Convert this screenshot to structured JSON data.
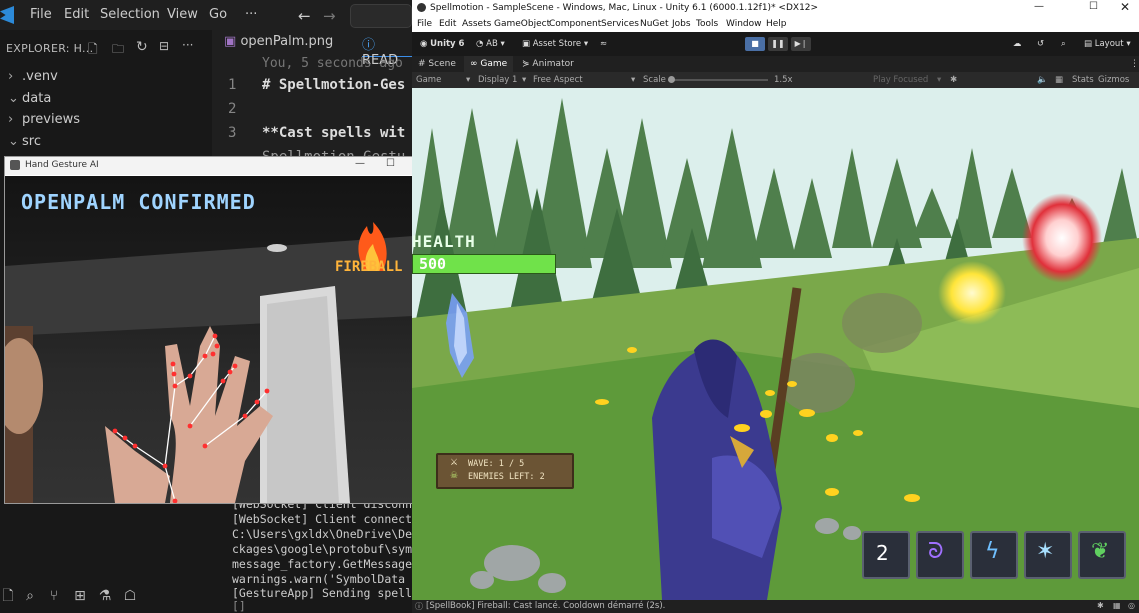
{
  "vscode": {
    "menu": [
      "File",
      "Edit",
      "Selection",
      "View",
      "Go",
      "···"
    ],
    "explorer_header": "EXPLORER: H...",
    "tree": [
      {
        "label": ".venv",
        "chevron": "›"
      },
      {
        "label": "data",
        "chevron": "⌄"
      },
      {
        "label": "previews",
        "chevron": "›"
      },
      {
        "label": "src",
        "chevron": "⌄"
      }
    ],
    "tabs": [
      "openPalm.png",
      "READ"
    ],
    "blame": "You, 5 seconds ago",
    "code_lines": [
      {
        "num": "1",
        "text": "# Spellmotion-Ges"
      },
      {
        "num": "2",
        "text": ""
      },
      {
        "num": "3",
        "text": "**Cast spells wit"
      }
    ],
    "code_partial": "Spellmotion-Gestu",
    "terminal": [
      "[WebSocket] Client disconn",
      "[WebSocket] Client connecte",
      "C:\\Users\\gxldx\\OneDrive\\Des",
      "ckages\\google\\protobuf\\symb",
      "  message_factory.GetMessage",
      "  warnings.warn('SymbolData",
      "[GestureApp] Sending spell",
      "[]"
    ]
  },
  "gesture_window": {
    "title": "Hand Gesture AI",
    "status": "OPENPALM CONFIRMED",
    "spell_label": "FIREBALL"
  },
  "unity": {
    "title": "Spellmotion - SampleScene - Windows, Mac, Linux - Unity 6.1 (6000.1.12f1)* <DX12>",
    "menu": [
      "File",
      "Edit",
      "Assets",
      "GameObject",
      "Component",
      "Services",
      "NuGet",
      "Jobs",
      "Tools",
      "Window",
      "Help"
    ],
    "toolbar": {
      "unity": "Unity 6",
      "account": "AB",
      "store": "Asset Store",
      "layout": "Layout"
    },
    "tabs": [
      "Scene",
      "Game",
      "Animator"
    ],
    "gamebar": {
      "mode": "Game",
      "display": "Display 1",
      "aspect": "Free Aspect",
      "scale_label": "Scale",
      "scale_value": "1.5x",
      "play_focused": "Play Focused",
      "stats": "Stats",
      "gizmos": "Gizmos"
    },
    "hud": {
      "health_label": "HEALTH",
      "health_value": "500",
      "wave": "WAVE: 1 / 5",
      "enemies": "ENEMIES LEFT: 2",
      "slots": [
        "2",
        "",
        "",
        "",
        ""
      ]
    },
    "status": "[SpellBook] Fireball: Cast lancé. Cooldown démarré (2s)."
  }
}
